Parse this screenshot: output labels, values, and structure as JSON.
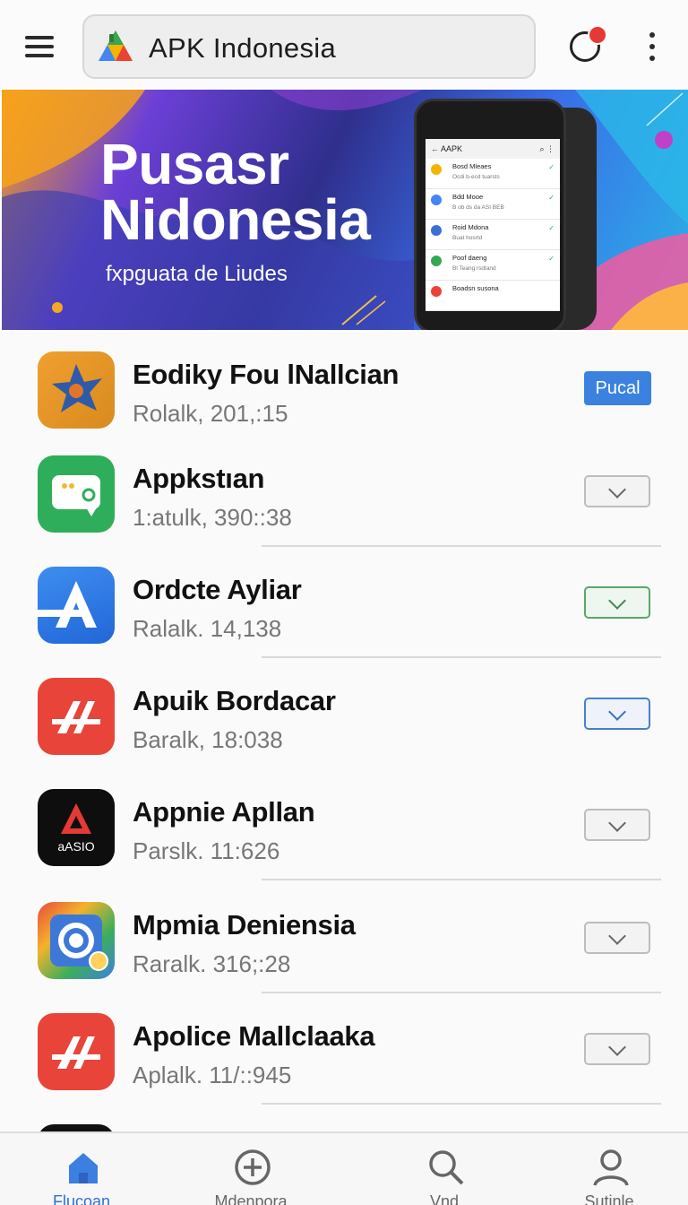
{
  "topbar": {
    "brand": "APK Indonesia",
    "notification_count": ""
  },
  "banner": {
    "title_line1": "Pusasr",
    "title_line2": "Nidonesia",
    "subtitle": "fxpguata de Liudes",
    "phone": {
      "title": "AAPK",
      "rows": [
        {
          "title": "Bosd Mleaes",
          "sub": "Ocdi b-ecd tuarsts"
        },
        {
          "title": "Bdd Mooe",
          "sub": "B ob ds da ASI BEB"
        },
        {
          "title": "Roid Mdona",
          "sub": "Buat hosrtd"
        },
        {
          "title": "Poof daeng",
          "sub": "Bl Teang rsdtand"
        },
        {
          "title": "Boadsn susona",
          "sub": ""
        }
      ]
    }
  },
  "apps": [
    {
      "name": "Eodiky Fou lNallcian",
      "meta": "Rolalk, 201,:15",
      "action": "Pucal"
    },
    {
      "name": "Appkstıan",
      "meta": "1:atulk, 390::38"
    },
    {
      "name": "Ordcte Ayliar",
      "meta": "Ralalk. 14,138"
    },
    {
      "name": "Apuik Bordacar",
      "meta": "Baralk, 18:038"
    },
    {
      "name": "Appnie Apllan",
      "meta": "Parslk. 11:626",
      "icon_text": "aASIO"
    },
    {
      "name": "Mpmia Deniensia",
      "meta": "Raralk. 316;:28"
    },
    {
      "name": "Apolice Mallclaaka",
      "meta": "Aplalk. 11/::945"
    }
  ],
  "nav": [
    {
      "label": "Flucoan",
      "icon": "home-icon"
    },
    {
      "label": "Mdenpora",
      "icon": "add-circle-icon"
    },
    {
      "label": "Vnd",
      "icon": "search-icon"
    },
    {
      "label": "Sutinle",
      "icon": "profile-icon"
    }
  ],
  "colors": {
    "accent": "#3b82e0",
    "nav_active": "#2f6fd6",
    "badge": "#e53935"
  }
}
